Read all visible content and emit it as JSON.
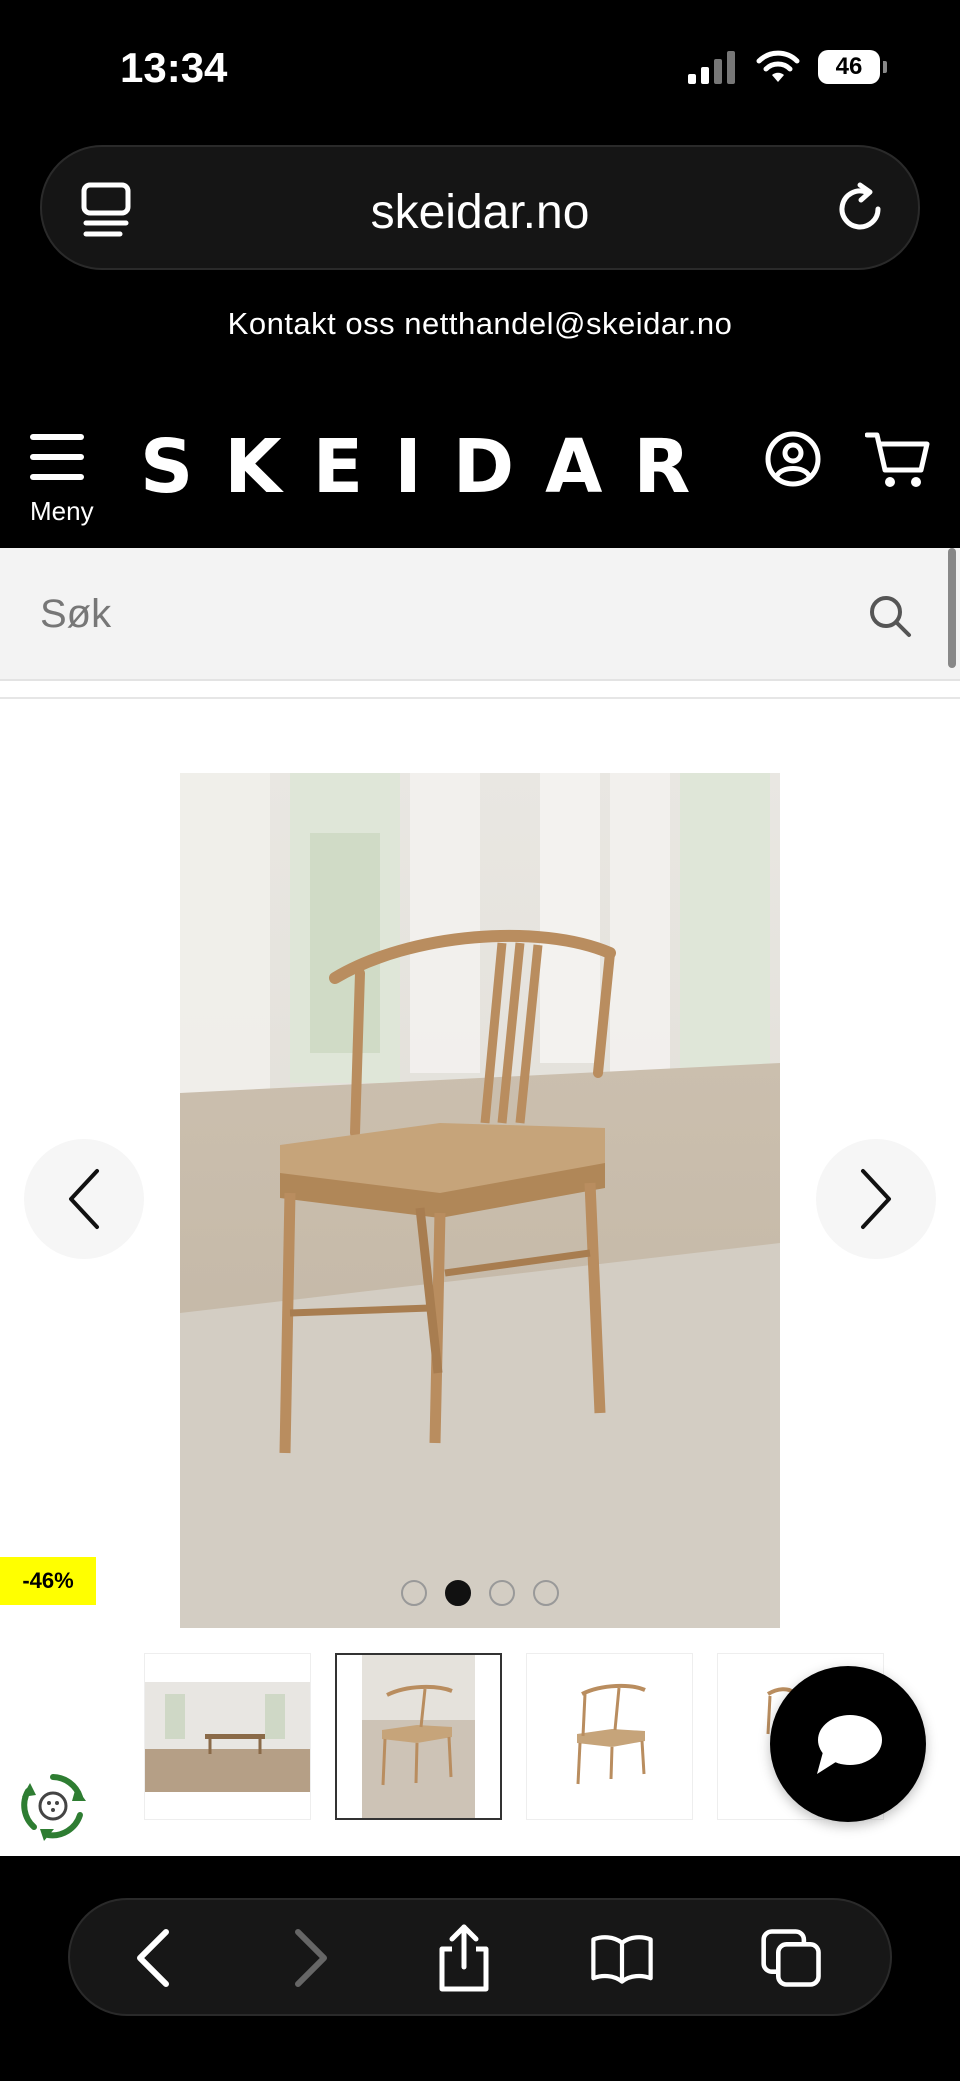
{
  "status": {
    "time": "13:34",
    "battery": "46"
  },
  "browser": {
    "url": "skeidar.no"
  },
  "site": {
    "contact": "Kontakt oss netthandel@skeidar.no",
    "logo": "SKEIDAR",
    "menu_label": "Meny"
  },
  "search": {
    "placeholder": "Søk"
  },
  "product": {
    "discount": "-46%",
    "carousel_total": 4,
    "carousel_active": 2,
    "thumbnails": 4,
    "thumbnail_selected": 2
  },
  "icons": {
    "tabs": "tabs-icon",
    "reload": "reload-icon",
    "menu": "hamburger-icon",
    "account": "user-icon",
    "cart": "cart-icon",
    "search": "search-icon",
    "prev": "chevron-left-icon",
    "next": "chevron-right-icon",
    "chat": "chat-bubble-icon",
    "eco": "recycle-icon",
    "back": "back-icon",
    "forward": "forward-icon",
    "share": "share-icon",
    "bookmarks": "book-icon",
    "tab-switcher": "tab-switcher-icon"
  },
  "colors": {
    "badge": "#ffff00",
    "wood": "#c49a6c",
    "eco": "#2e7d32"
  }
}
